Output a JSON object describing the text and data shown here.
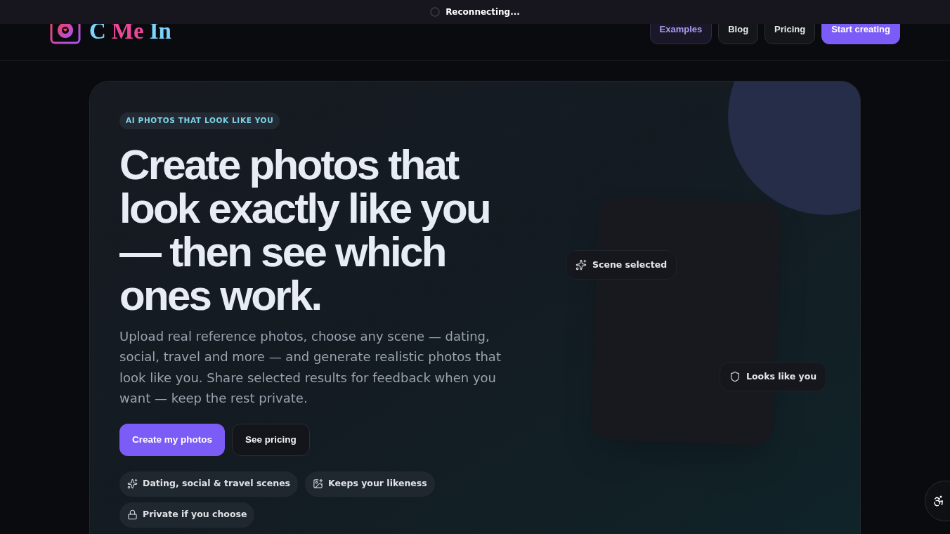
{
  "banner": {
    "text": "Reconnecting..."
  },
  "logo": {
    "parts": [
      {
        "text": "C",
        "color": "#7dd3fc"
      },
      {
        "text": "Me",
        "color": "#ec4899"
      },
      {
        "text": "In",
        "color": "#7dd3fc"
      }
    ]
  },
  "nav": [
    {
      "label": "Examples",
      "kind": "link",
      "selected": true
    },
    {
      "label": "Blog",
      "kind": "link",
      "selected": false
    },
    {
      "label": "Pricing",
      "kind": "link",
      "selected": false
    },
    {
      "label": "Start creating",
      "kind": "primary",
      "selected": false
    }
  ],
  "hero": {
    "eyebrow": "AI PHOTOS THAT LOOK LIKE YOU",
    "title": "Create photos that look exactly like you — then see which ones work.",
    "description": "Upload real reference photos, choose any scene — dating, social, travel and more — and generate realistic photos that look like you. Share selected results for feedback when you want — keep the rest private.",
    "buttons": [
      {
        "label": "Create my photos",
        "kind": "primary"
      },
      {
        "label": "See pricing",
        "kind": "secondary"
      }
    ],
    "features": [
      {
        "label": "Dating, social & travel scenes",
        "kind": "scenes"
      },
      {
        "label": "Keeps your likeness",
        "kind": "likeness"
      },
      {
        "label": "Private if you choose",
        "kind": "privacy"
      }
    ],
    "preview_chips": [
      {
        "label": "Scene selected",
        "kind": "scene"
      },
      {
        "label": "Looks like you",
        "kind": "likeness"
      }
    ]
  }
}
